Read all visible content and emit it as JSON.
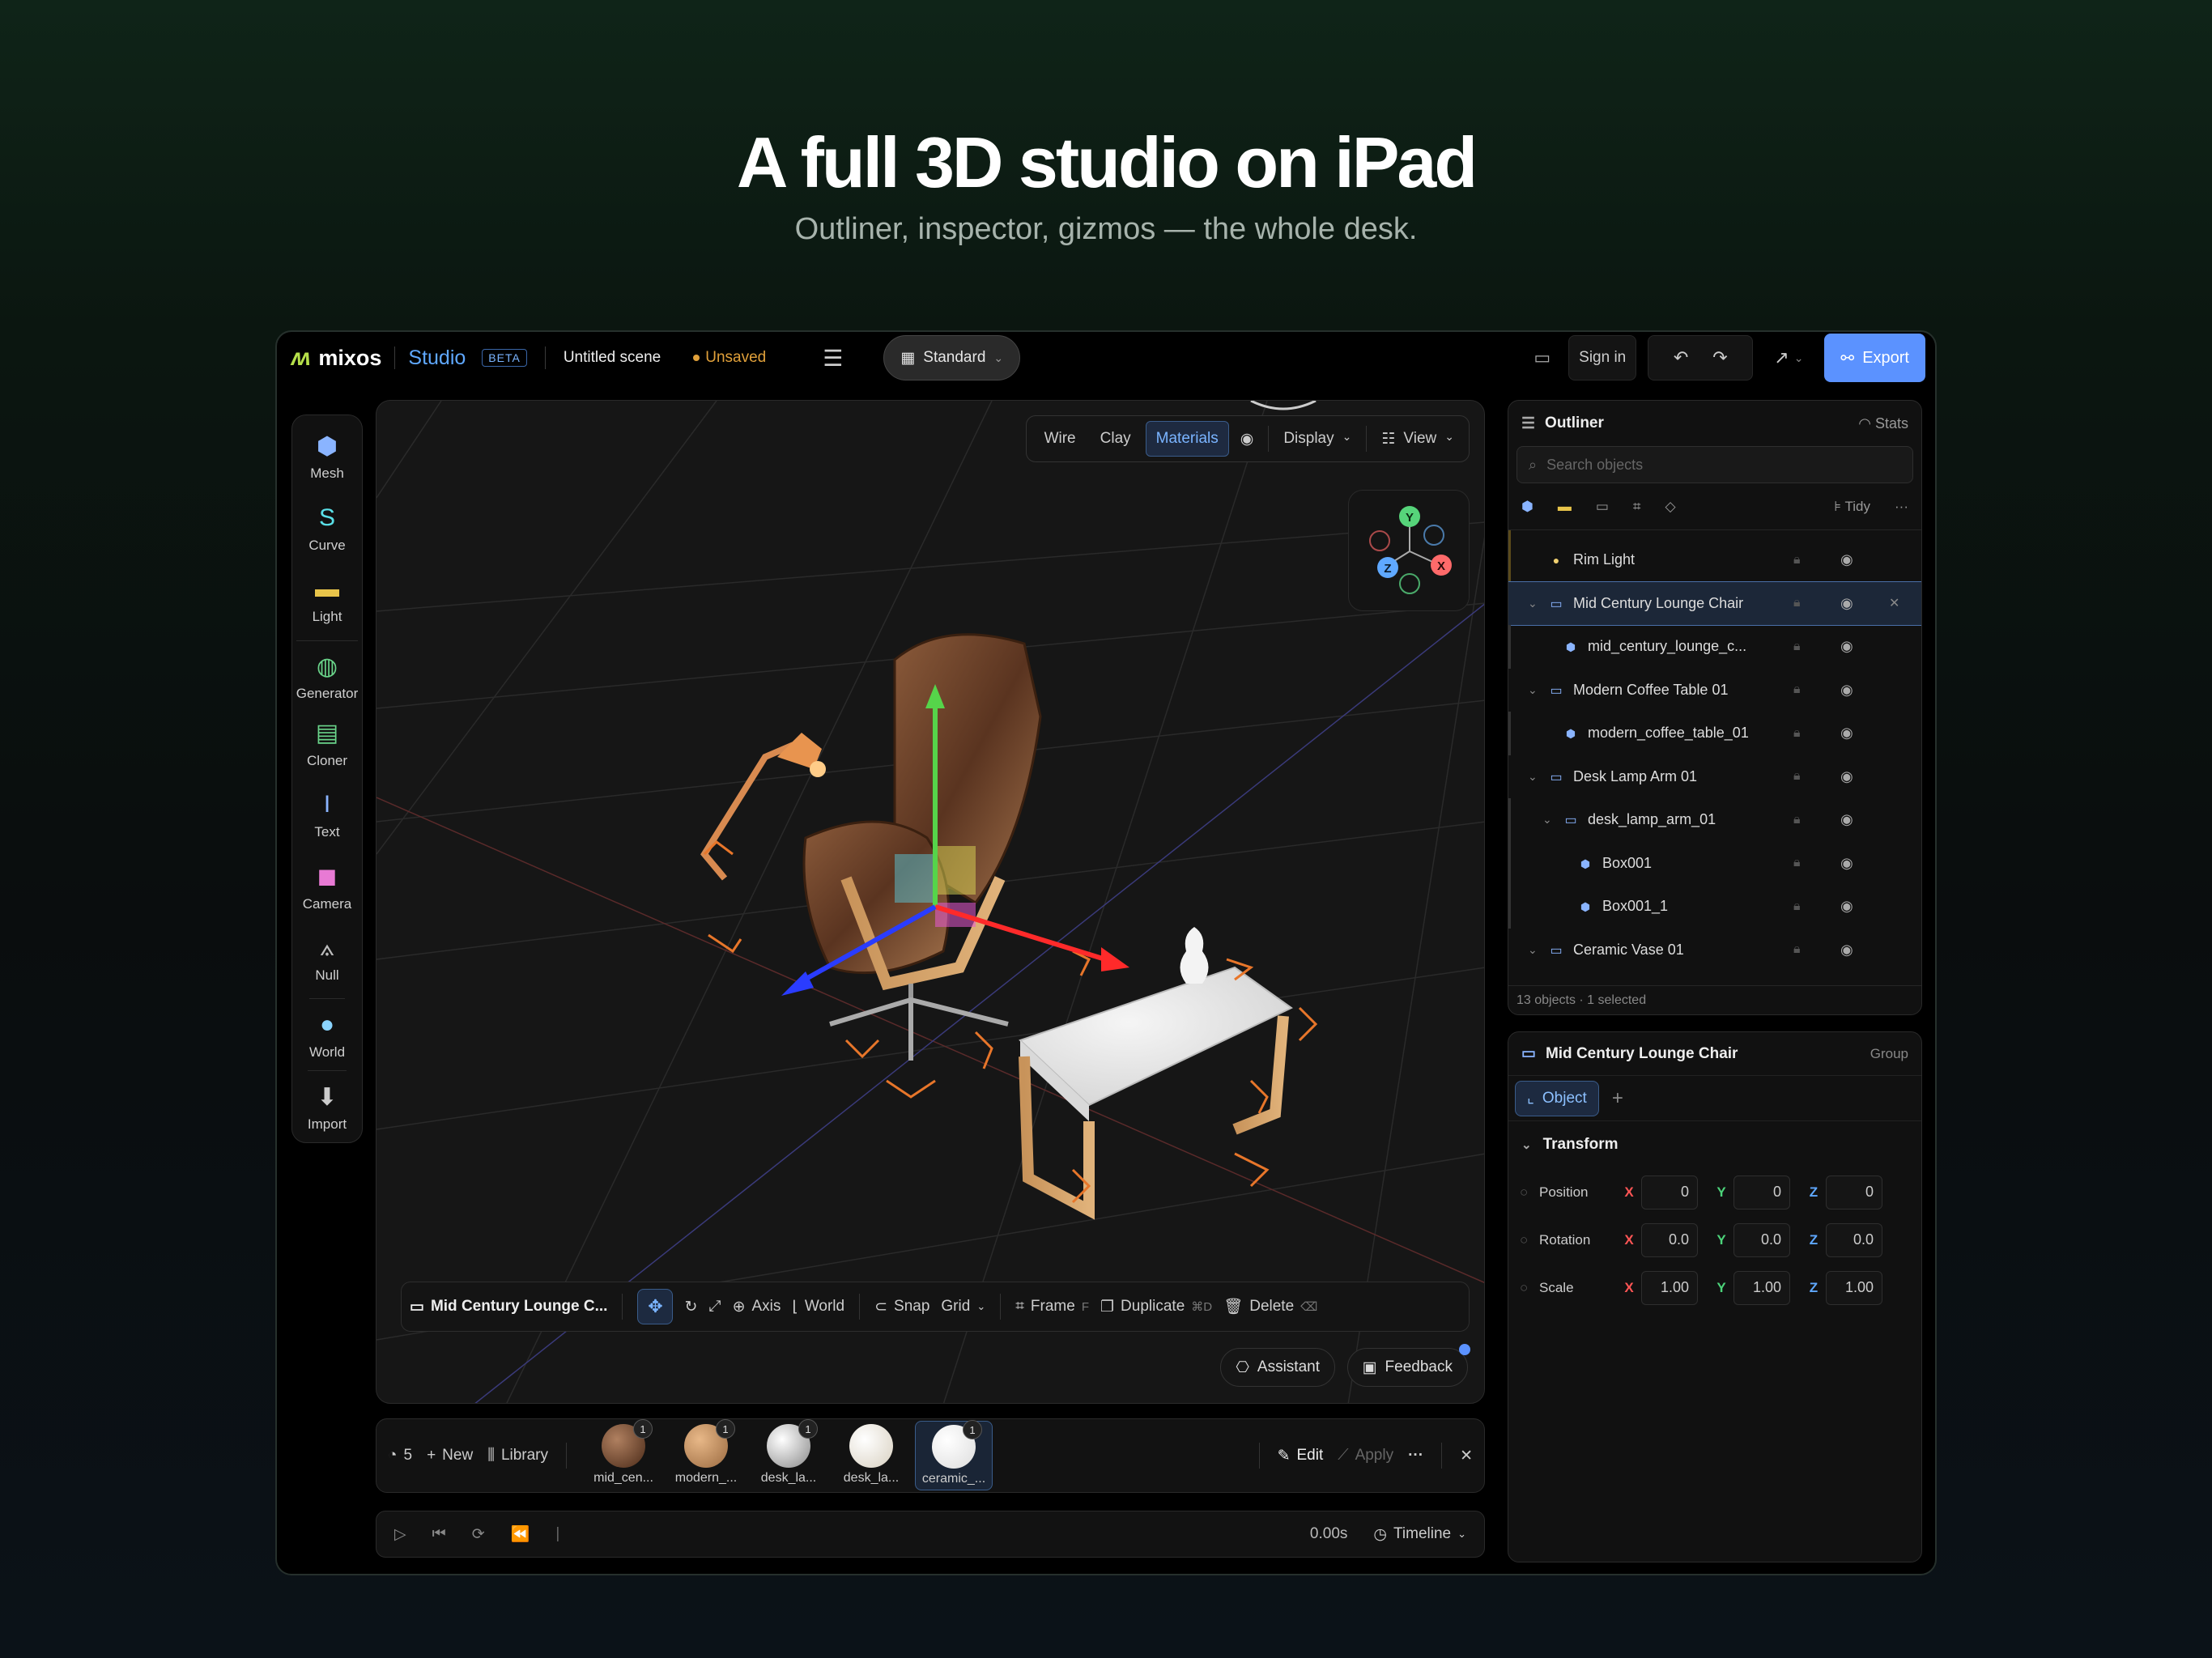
{
  "hero": {
    "title": "A full 3D studio on iPad",
    "subtitle": "Outliner, inspector, gizmos — the whole desk."
  },
  "topbar": {
    "brand": "mixos",
    "product": "Studio",
    "badge": "BETA",
    "scene": "Untitled scene",
    "status": "Unsaved",
    "mode": "Standard",
    "signin": "Sign in",
    "export": "Export"
  },
  "tools": [
    {
      "label": "Mesh",
      "icon": "cube-icon"
    },
    {
      "label": "Curve",
      "icon": "curve-icon"
    },
    {
      "label": "Light",
      "icon": "light-icon"
    },
    {
      "label": "Generator",
      "icon": "generator-icon"
    },
    {
      "label": "Cloner",
      "icon": "cloner-icon"
    },
    {
      "label": "Text",
      "icon": "text-icon"
    },
    {
      "label": "Camera",
      "icon": "camera-icon"
    },
    {
      "label": "Null",
      "icon": "null-icon"
    },
    {
      "label": "World",
      "icon": "world-icon"
    },
    {
      "label": "Import",
      "icon": "import-icon"
    }
  ],
  "viewport": {
    "shading": [
      "Wire",
      "Clay",
      "Materials"
    ],
    "shading_active": "Materials",
    "display": "Display",
    "view": "View",
    "gizmo_axes": [
      "Y",
      "Z",
      "X"
    ],
    "bottombar": {
      "selection": "Mid Century Lounge C...",
      "axis": "Axis",
      "world": "World",
      "snap": "Snap",
      "grid": "Grid",
      "frame": "Frame",
      "frame_key": "F",
      "duplicate": "Duplicate",
      "duplicate_key": "⌘D",
      "delete": "Delete"
    },
    "assistant": "Assistant",
    "feedback": "Feedback"
  },
  "materials": {
    "count": "5",
    "new": "New",
    "library": "Library",
    "edit": "Edit",
    "apply": "Apply",
    "items": [
      {
        "label": "mid_cen...",
        "badge": "1"
      },
      {
        "label": "modern_...",
        "badge": "1"
      },
      {
        "label": "desk_la...",
        "badge": "1"
      },
      {
        "label": "desk_la...",
        "badge": ""
      },
      {
        "label": "ceramic_...",
        "badge": "1"
      }
    ]
  },
  "timeline": {
    "time": "0.00s",
    "label": "Timeline"
  },
  "outliner": {
    "title": "Outliner",
    "stats": "Stats",
    "search_placeholder": "Search objects",
    "tidy": "Tidy",
    "rows": [
      {
        "name": "Rim Light",
        "kind": "light",
        "depth": 0,
        "expand": false,
        "selected": false
      },
      {
        "name": "Mid Century Lounge Chair",
        "kind": "group",
        "depth": 0,
        "expand": true,
        "selected": true
      },
      {
        "name": "mid_century_lounge_c...",
        "kind": "mesh",
        "depth": 1,
        "expand": false,
        "selected": false
      },
      {
        "name": "Modern Coffee Table 01",
        "kind": "group",
        "depth": 0,
        "expand": true,
        "selected": false
      },
      {
        "name": "modern_coffee_table_01",
        "kind": "mesh",
        "depth": 1,
        "expand": false,
        "selected": false
      },
      {
        "name": "Desk Lamp Arm 01",
        "kind": "group",
        "depth": 0,
        "expand": true,
        "selected": false
      },
      {
        "name": "desk_lamp_arm_01",
        "kind": "group",
        "depth": 1,
        "expand": true,
        "selected": false
      },
      {
        "name": "Box001",
        "kind": "mesh",
        "depth": 2,
        "expand": false,
        "selected": false
      },
      {
        "name": "Box001_1",
        "kind": "mesh",
        "depth": 2,
        "expand": false,
        "selected": false
      },
      {
        "name": "Ceramic Vase 01",
        "kind": "group",
        "depth": 0,
        "expand": true,
        "selected": false
      }
    ],
    "footer": "13 objects · 1 selected"
  },
  "inspector": {
    "title": "Mid Century Lounge Chair",
    "type": "Group",
    "tab": "Object",
    "section": "Transform",
    "props": [
      {
        "label": "Position",
        "x": "0",
        "y": "0",
        "z": "0"
      },
      {
        "label": "Rotation",
        "x": "0.0",
        "y": "0.0",
        "z": "0.0"
      },
      {
        "label": "Scale",
        "x": "1.00",
        "y": "1.00",
        "z": "1.00"
      }
    ]
  },
  "colors": {
    "accent": "#5b92ff",
    "unsaved": "#e0a03a",
    "axis_x": "#ff3333",
    "axis_y": "#4cd47a",
    "axis_z": "#2a3cff"
  }
}
